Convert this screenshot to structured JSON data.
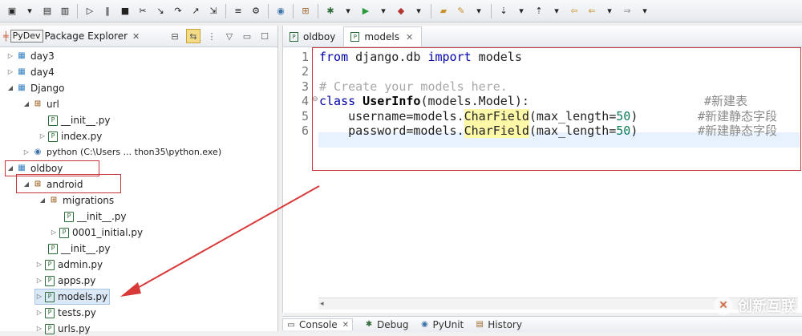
{
  "toolbar": {
    "icons": [
      "new-icon",
      "save-icon",
      "save-all-icon",
      "run-icon",
      "pause-icon",
      "stop-icon",
      "disconnect-icon",
      "step-into-icon",
      "step-over-icon",
      "step-return-icon",
      "drop-to-frame-icon",
      "use-step-filters-icon",
      "toggle-mark-icon",
      "python-icon",
      "open-type-icon",
      "debug-icon",
      "run-green-icon",
      "external-tools-icon",
      "open-folder-icon",
      "pen-icon",
      "next-annotation-icon",
      "prev-annotation-icon",
      "last-edit-icon",
      "back-icon",
      "forward-icon"
    ]
  },
  "left_panel": {
    "tooltip": "PyDev",
    "title": "Package Explorer",
    "close": "✕",
    "tree": [
      {
        "label": "day3",
        "type": "project",
        "twisty": "▷"
      },
      {
        "label": "day4",
        "type": "project",
        "twisty": "▷"
      },
      {
        "label": "Django",
        "type": "project",
        "twisty": "◢"
      },
      {
        "label": "url",
        "type": "package",
        "twisty": "◢"
      },
      {
        "label": "__init__.py",
        "type": "file",
        "twisty": ""
      },
      {
        "label": "index.py",
        "type": "file",
        "twisty": "▷"
      },
      {
        "label": "python  (C:\\Users ... thon35\\python.exe)",
        "type": "python",
        "twisty": "▷"
      },
      {
        "label": "oldboy",
        "type": "project",
        "twisty": "◢"
      },
      {
        "label": "android",
        "type": "package",
        "twisty": "◢"
      },
      {
        "label": "migrations",
        "type": "package",
        "twisty": "◢"
      },
      {
        "label": "__init__.py",
        "type": "file",
        "twisty": ""
      },
      {
        "label": "0001_initial.py",
        "type": "file",
        "twisty": "▷"
      },
      {
        "label": "__init__.py",
        "type": "file",
        "twisty": ""
      },
      {
        "label": "admin.py",
        "type": "file",
        "twisty": "▷"
      },
      {
        "label": "apps.py",
        "type": "file",
        "twisty": "▷"
      },
      {
        "label": "models.py",
        "type": "file",
        "twisty": "▷"
      },
      {
        "label": "tests.py",
        "type": "file",
        "twisty": "▷"
      },
      {
        "label": "urls.py",
        "type": "file",
        "twisty": "▷"
      }
    ]
  },
  "editor": {
    "tabs": [
      {
        "label": "oldboy"
      },
      {
        "label": "models",
        "close": "✕"
      }
    ],
    "line_numbers": [
      "1",
      "2",
      "3",
      "4",
      "5",
      "6"
    ],
    "lines": {
      "l1_kw1": "from",
      "l1_mod": " django.db ",
      "l1_kw2": "import",
      "l1_rest": " models",
      "l3": "# Create your models here.",
      "l4_kw": "class",
      "l4_name": " UserInfo",
      "l4_rest": "(models.Model):",
      "l4_comment": "#新建表",
      "l5_a": "    username=models.",
      "l5_b": "CharField",
      "l5_c": "(max_length=",
      "l5_num": "50",
      "l5_d": ")",
      "l5_comment": "#新建静态字段",
      "l6_a": "    password=models.",
      "l6_b": "CharField",
      "l6_c": "(max_length=",
      "l6_num": "50",
      "l6_d": ")",
      "l6_comment": "#新建静态字段"
    }
  },
  "bottom_tabs": [
    {
      "label": "Console",
      "icon": "console-icon"
    },
    {
      "label": "Debug",
      "icon": "debug-icon"
    },
    {
      "label": "PyUnit",
      "icon": "pyunit-icon"
    },
    {
      "label": "History",
      "icon": "history-icon"
    }
  ],
  "watermark": "创新互联"
}
